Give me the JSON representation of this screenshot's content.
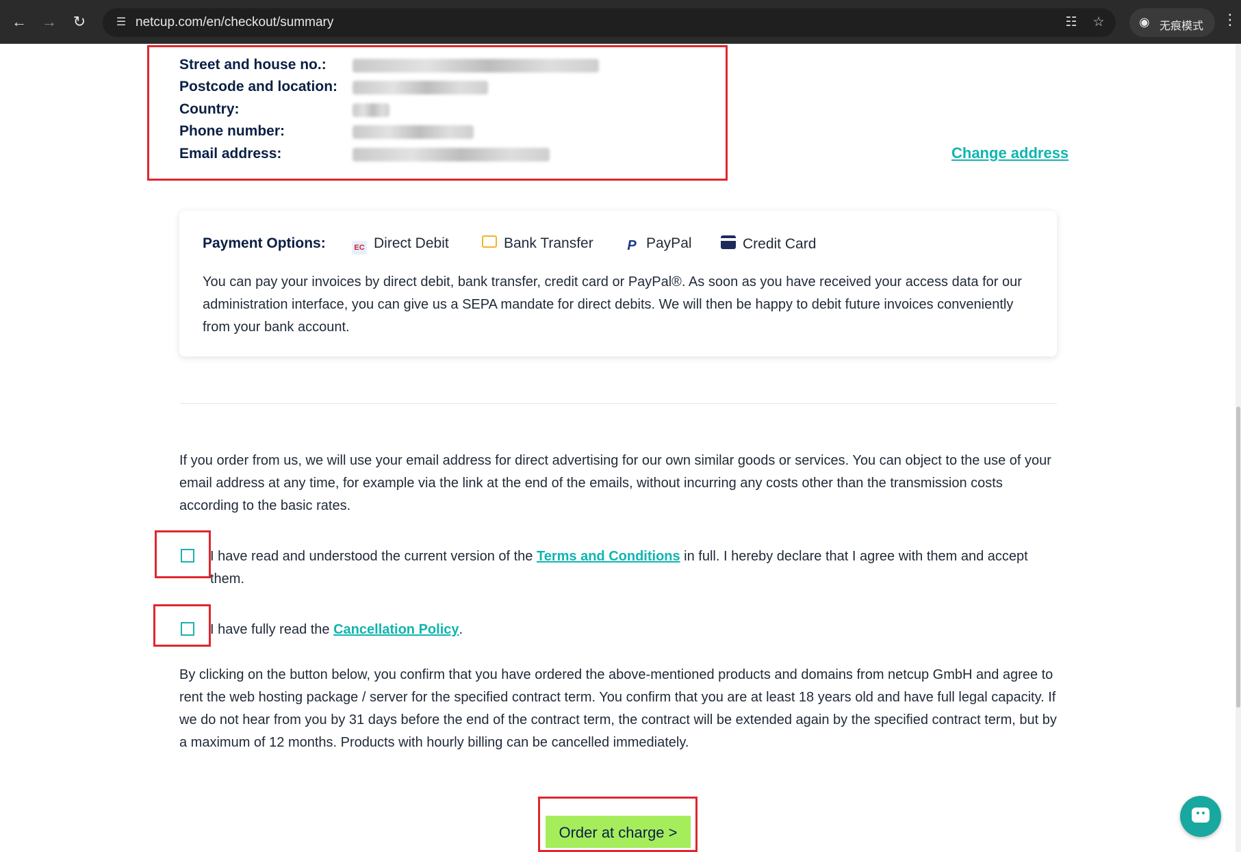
{
  "browser": {
    "url": "netcup.com/en/checkout/summary",
    "incognito_label": "无痕模式"
  },
  "address": {
    "labels": {
      "street": "Street and house no.:",
      "postcode": "Postcode and location:",
      "country": "Country:",
      "phone": "Phone number:",
      "email": "Email address:"
    },
    "change_address": "Change address"
  },
  "payment": {
    "title": "Payment Options:",
    "options": [
      {
        "label": "Direct Debit",
        "icon": "direct-debit-icon"
      },
      {
        "label": "Bank Transfer",
        "icon": "bank-transfer-icon"
      },
      {
        "label": "PayPal",
        "icon": "paypal-icon"
      },
      {
        "label": "Credit Card",
        "icon": "credit-card-icon"
      }
    ],
    "description": "You can pay your invoices by direct debit, bank transfer, credit card or PayPal®. As soon as you have received your access data for our administration interface, you can give us a SEPA mandate for direct debits. We will then be happy to debit future invoices conveniently from your bank account."
  },
  "advertising_notice": "If you order from us, we will use your email address for direct advertising for our own similar goods or services. You can object to the use of your email address at any time, for example via the link at the end of the emails, without incurring any costs other than the transmission costs according to the basic rates.",
  "terms": {
    "prefix": "I have read and understood the current version of the ",
    "link": "Terms and Conditions",
    "suffix": " in full. I hereby declare that I agree with them and accept them.",
    "checked": false
  },
  "cancellation": {
    "prefix": "I have fully read the ",
    "link": "Cancellation Policy",
    "suffix": ".",
    "checked": false
  },
  "confirmation_text": "By clicking on the button below, you confirm that you have ordered the above-mentioned products and domains from netcup GmbH and agree to rent the web hosting package / server for the specified contract term. You confirm that you are at least 18 years old and have full legal capacity. If we do not hear from you by 31 days before the end of the contract term, the contract will be extended again by the specified contract term, but by a maximum of 12 months. Products with hourly billing can be cancelled immediately.",
  "order_button": "Order at charge >",
  "colors": {
    "accent_teal": "#0fb5b0",
    "order_button": "#a6ed5c",
    "navy": "#0a1f44",
    "highlight_red": "#e0262f"
  }
}
